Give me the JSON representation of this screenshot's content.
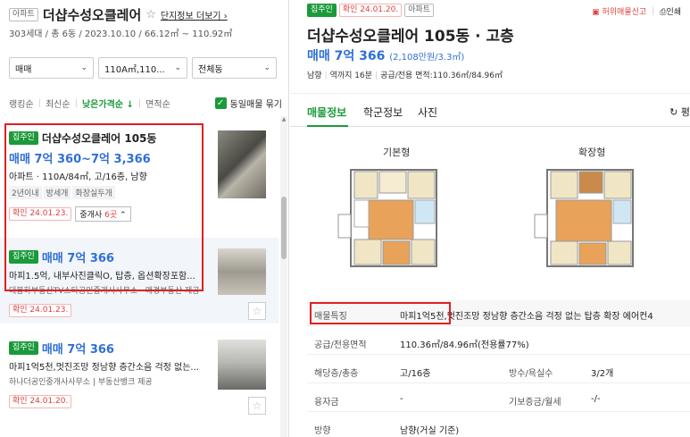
{
  "left": {
    "type_tag": "아파트",
    "complex_name": "더샵수성오클레어",
    "complex_more": "단지정보 더보기",
    "complex_info": "303세대 / 총 6동 / 2023.10.10 / 66.12㎡ ~ 110.92㎡",
    "filters": {
      "trade": "매매",
      "area": "110A㎡,110...",
      "dong": "전체동"
    },
    "sort": {
      "items": [
        "랭킹순",
        "최신순",
        "낮은가격순 ↓",
        "면적순"
      ],
      "active_index": 2,
      "same_listing_label": "동일매물 묶기",
      "same_listing_checked": true
    },
    "listings": [
      {
        "badge": "집주인",
        "title": "더샵수성오클레어 105동",
        "price": "매매 7억 360~7억 3,366",
        "detail": "아파트 · 110A/84㎡, 고/16층, 남향",
        "chips": [
          "2년이내",
          "방세개",
          "화장실두개"
        ],
        "confirm": "확인 24.01.23.",
        "agent_label": "중개사",
        "agent_count": "6곳"
      },
      {
        "badge": "집주인",
        "price": "매매 7억 366",
        "detail": "마피1.5억, 내부사진클릭O, 탑층, 옵션확장포함...",
        "agency": "대봉하부동산TV스타공인중개사사무소 · 매경부동산 제공",
        "confirm": "확인 24.01.23."
      },
      {
        "badge": "집주인",
        "price": "매매 7억 366",
        "detail": "마피1억5천,멋진조망 정남향 층간소음 걱정 없는...",
        "agency": "하나더공인중개사사무소 | 부동산뱅크 제공",
        "confirm": "확인 24.01.20."
      }
    ]
  },
  "right": {
    "badge_owner": "집주인",
    "badge_confirm": "확인 24.01.20.",
    "badge_type": "아파트",
    "report_label": "허위매물신고",
    "print_label": "인쇄",
    "title": "더샵수성오클레어 105동 · 고층",
    "price": "매매 7억 366",
    "price_unit": "(2,108만원/3.3㎡)",
    "info": [
      "남향",
      "역까지 16분",
      "공급/전용 면적:110.36㎡/84.96㎡"
    ],
    "tabs": [
      "매물정보",
      "학군정보",
      "사진"
    ],
    "refresh_label": "평",
    "plans": [
      "기본형",
      "확장형"
    ],
    "table": [
      {
        "k": "매물특징",
        "v": "마피1억5천,멋진조망 정남향 층간소음 걱정 없는 탑층 확장 에어컨4"
      },
      {
        "k": "공급/전용면적",
        "v": "110.36㎡/84.96㎡(전용률77%)"
      },
      {
        "k": "해당층/총층",
        "v": "고/16층",
        "k2": "방수/욕실수",
        "v2": "3/2개"
      },
      {
        "k": "융자금",
        "v": "-",
        "k2": "기보증금/월세",
        "v2": "-/-"
      },
      {
        "k": "방향",
        "v": "남향(거실 기준)"
      }
    ]
  },
  "colors": {
    "accent_green": "#1a9a3a",
    "price_blue": "#2f6fd6",
    "highlight_red": "#e02020"
  }
}
